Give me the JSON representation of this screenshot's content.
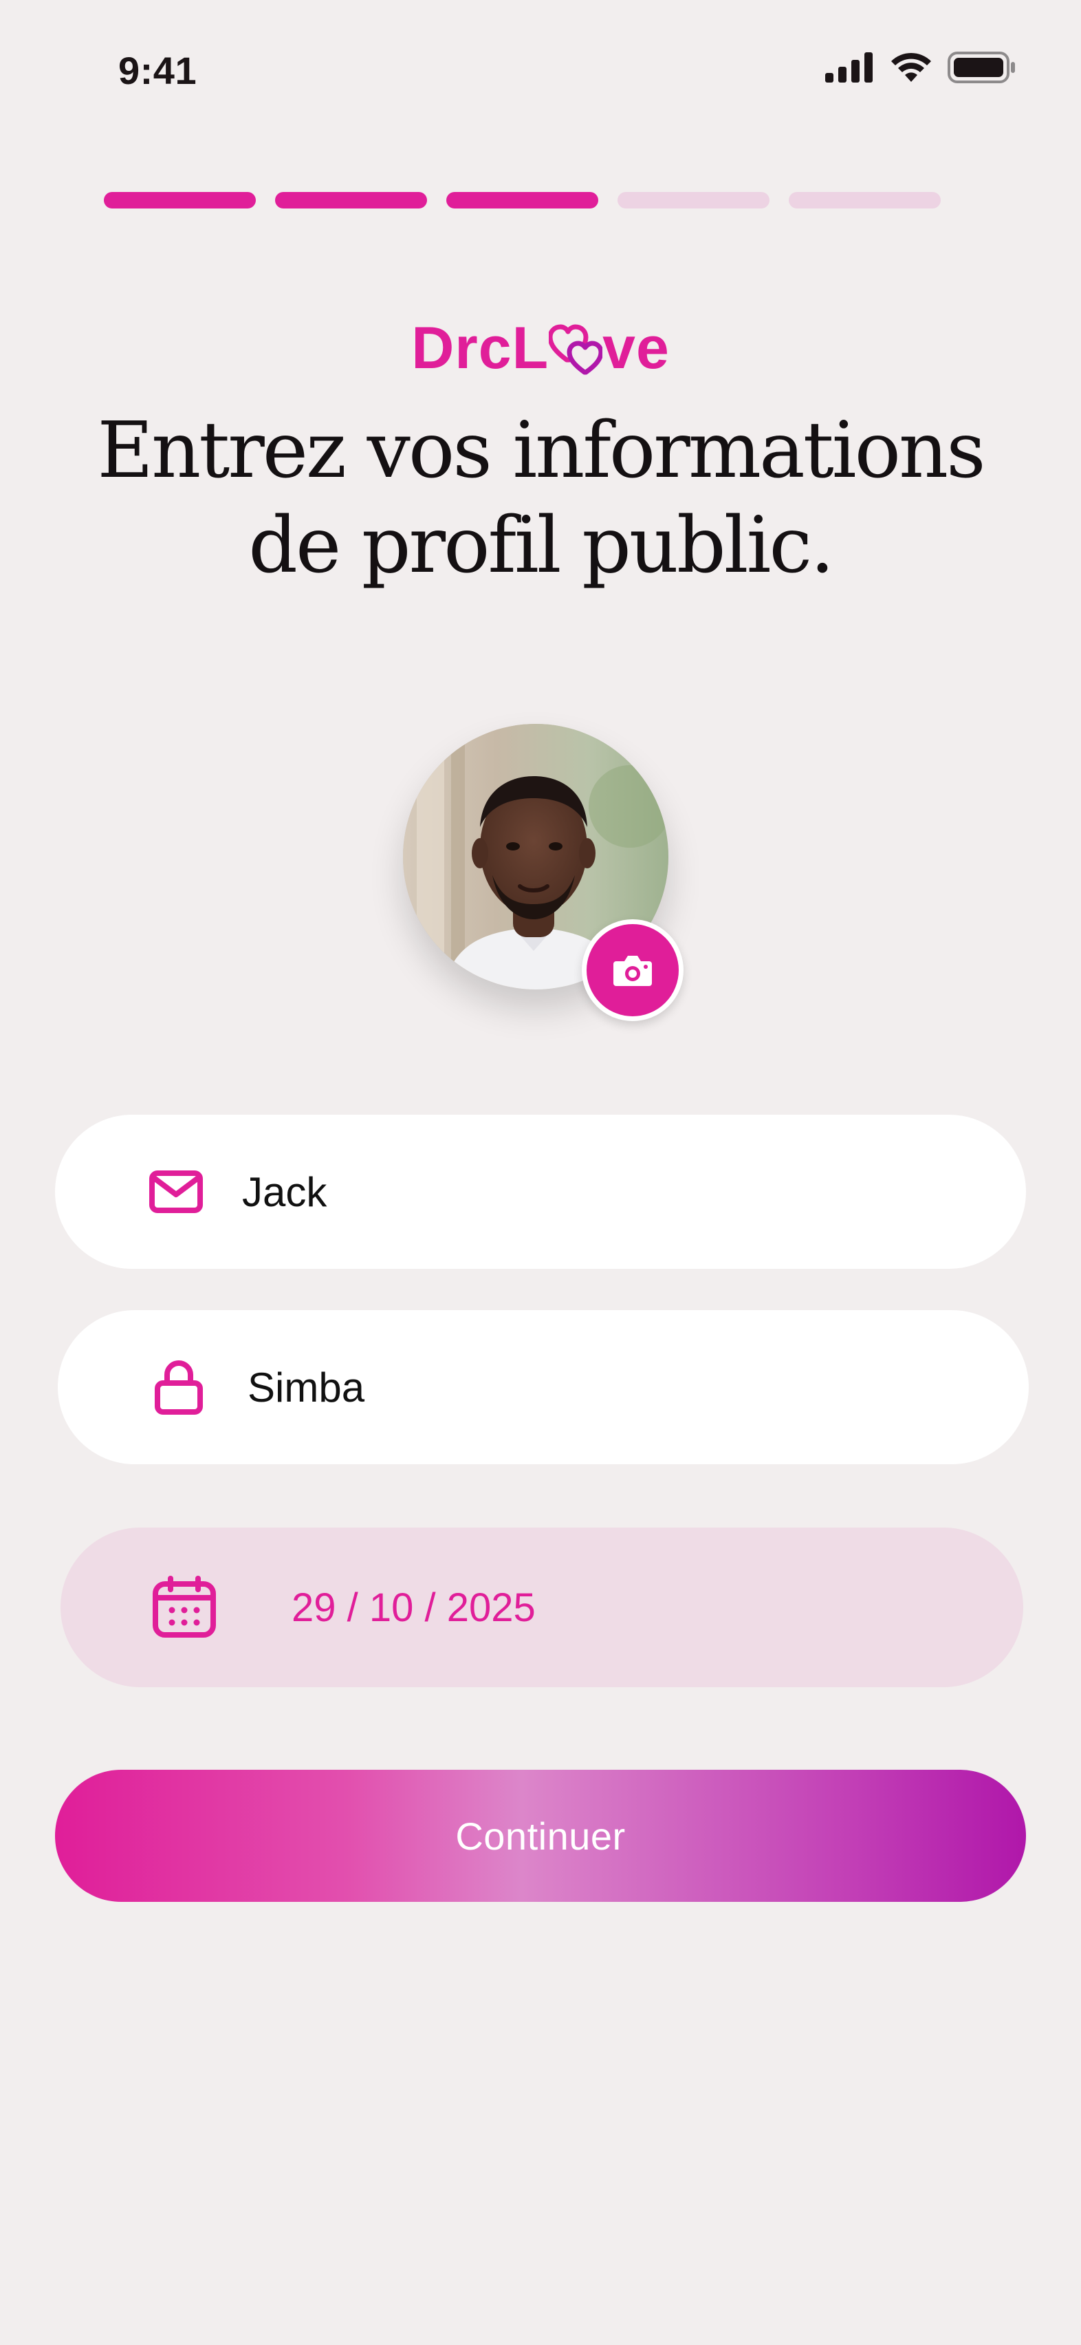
{
  "status_bar": {
    "time": "9:41"
  },
  "progress": {
    "total_steps": 5,
    "completed_steps": 3,
    "active_color": "#E01E99",
    "inactive_color": "#EDD3E3"
  },
  "brand": {
    "logo_text_prefix": "DrcL",
    "logo_text_suffix": "ve",
    "logo_letter_icon": "double-heart-icon",
    "color": "#E01E99"
  },
  "headline": {
    "line1": "Entrez vos informations",
    "line2": "de profil public."
  },
  "profile": {
    "avatar_icon": "avatar",
    "camera_icon": "camera-icon"
  },
  "form": {
    "first_name": {
      "icon": "mail-icon",
      "value": "Jack"
    },
    "last_name": {
      "icon": "lock-icon",
      "value": "Simba"
    },
    "birth_date": {
      "icon": "calendar-icon",
      "value": "29 / 10 / 2025"
    }
  },
  "cta": {
    "label": "Continuer"
  }
}
